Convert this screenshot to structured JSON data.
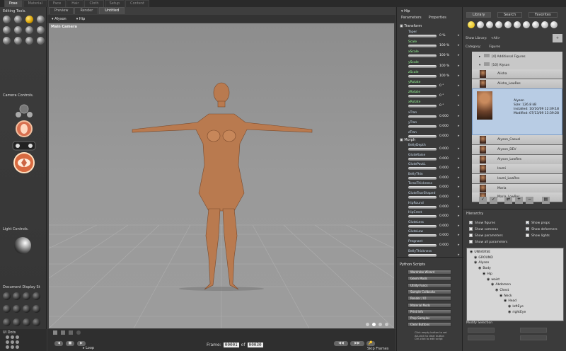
{
  "top_tabs": [
    "Pose",
    "Material",
    "Face",
    "Hair",
    "Cloth",
    "Setup",
    "Content"
  ],
  "left_panel": {
    "editing_tools_title": "Editing Tools.",
    "camera_controls_title": "Camera Controls.",
    "light_controls_title": "Light Controls.",
    "document_display_title": "Document Display St",
    "ui_dots_title": "UI Dots",
    "tool_icons": [
      "rotate-icon",
      "twist-icon",
      "translate-icon",
      "translate-in-out-icon",
      "scale-icon",
      "taper-icon",
      "chain-break-icon",
      "color-icon",
      "grouping-icon",
      "view-magnifier-icon",
      "morphing-icon",
      "direct-manipulation-icon"
    ]
  },
  "viewport": {
    "doc_tabs": [
      "Preview",
      "Render",
      "Untitled"
    ],
    "figure_select": "Alyson",
    "actor_select": "Hip",
    "camera_label": "Main Camera",
    "frame_label": "Frame:",
    "frame_current": "00001",
    "frame_of": "of",
    "frame_total": "00030",
    "loop_label": "Loop",
    "skip_frames_label": "Skip Frames"
  },
  "params": {
    "actor": "Hip",
    "tabs": [
      "Parameters",
      "Properties"
    ],
    "transform_title": "Transform",
    "transform": [
      {
        "name": "Taper",
        "value": "0 %"
      },
      {
        "name": "Scale",
        "value": "100 %"
      },
      {
        "name": "xScale",
        "value": "100 %"
      },
      {
        "name": "yScale",
        "value": "100 %"
      },
      {
        "name": "zScale",
        "value": "100 %"
      },
      {
        "name": "yRotate",
        "value": "0 °"
      },
      {
        "name": "zRotate",
        "value": "0 °"
      },
      {
        "name": "xRotate",
        "value": "0 °"
      },
      {
        "name": "xTran",
        "value": "0.000"
      },
      {
        "name": "yTran",
        "value": "0.000"
      },
      {
        "name": "zTran",
        "value": "0.000"
      }
    ],
    "morph_title": "Morph",
    "morphs": [
      {
        "name": "BellyDepth",
        "value": "0.000"
      },
      {
        "name": "GluteRaise",
        "value": "0.000"
      },
      {
        "name": "GlutePoutL",
        "value": "0.000"
      },
      {
        "name": "BellyThin",
        "value": "0.000"
      },
      {
        "name": "TorsoThickness",
        "value": "0.000"
      },
      {
        "name": "GluteTearShaped",
        "value": "0.000"
      },
      {
        "name": "HipRound",
        "value": "0.000"
      },
      {
        "name": "HipCrest",
        "value": "0.000"
      },
      {
        "name": "GluteLess",
        "value": "0.000"
      },
      {
        "name": "GluteLow",
        "value": "0.000"
      },
      {
        "name": "Pregnant",
        "value": "0.000"
      },
      {
        "name": "BellyThickness",
        "value": ""
      }
    ],
    "python_title": "Python Scripts",
    "python_buttons": [
      "Wardrobe Wizard",
      "Geom Mods",
      "Utility Funcs",
      "Sample Callbacks",
      "Render / IO",
      "Material Mods",
      "Print Info",
      "Prop Samples",
      "Clear Buttons"
    ],
    "python_hint": [
      "Click empty button to set",
      "Alt-click to clear button",
      "Ctrl-click to edit script"
    ]
  },
  "library": {
    "tabs": [
      "Library",
      "Search",
      "Favorites"
    ],
    "show_library_label": "Show Library:",
    "show_library_value": "<All>",
    "category_label": "Category:",
    "category_value": "Figures",
    "folders": [
      "[4]  Additional Figures",
      "[10]  Alyson"
    ],
    "items": [
      "Alisha",
      "Alisha_LowRes",
      "Alyson",
      "Alyson_Casual",
      "Alyson_DEV",
      "Alyson_LowRes",
      "Izumi",
      "Izumi_LowRes",
      "Maria",
      "Maria_LowRes"
    ],
    "selected": {
      "name": "Alyson",
      "size": "Size:  126.8 kB",
      "installed": "Installed:  10/10/09 12:39:18",
      "modified": "Modified:  07/13/09 13:39:28"
    }
  },
  "hierarchy": {
    "title": "Hierarchy",
    "options": [
      {
        "label": "Show figures",
        "checked": true
      },
      {
        "label": "Show props",
        "checked": true
      },
      {
        "label": "Show cameras",
        "checked": false
      },
      {
        "label": "Show deformers",
        "checked": true
      },
      {
        "label": "Show parameters",
        "checked": false
      },
      {
        "label": "Show lights",
        "checked": false
      },
      {
        "label": "Show all parameters",
        "checked": false
      }
    ],
    "tree": [
      {
        "label": "UNIVERSE",
        "level": 0
      },
      {
        "label": "GROUND",
        "level": 1
      },
      {
        "label": "Alyson",
        "level": 1
      },
      {
        "label": "Body",
        "level": 2
      },
      {
        "label": "Hip",
        "level": 3
      },
      {
        "label": "waist",
        "level": 4
      },
      {
        "label": "Abdomen",
        "level": 5
      },
      {
        "label": "Chest",
        "level": 6
      },
      {
        "label": "Neck",
        "level": 7
      },
      {
        "label": "Head",
        "level": 8
      },
      {
        "label": "leftEye",
        "level": 9
      },
      {
        "label": "rightEye",
        "level": 9
      }
    ],
    "modify_selection": "Modify Selection"
  }
}
